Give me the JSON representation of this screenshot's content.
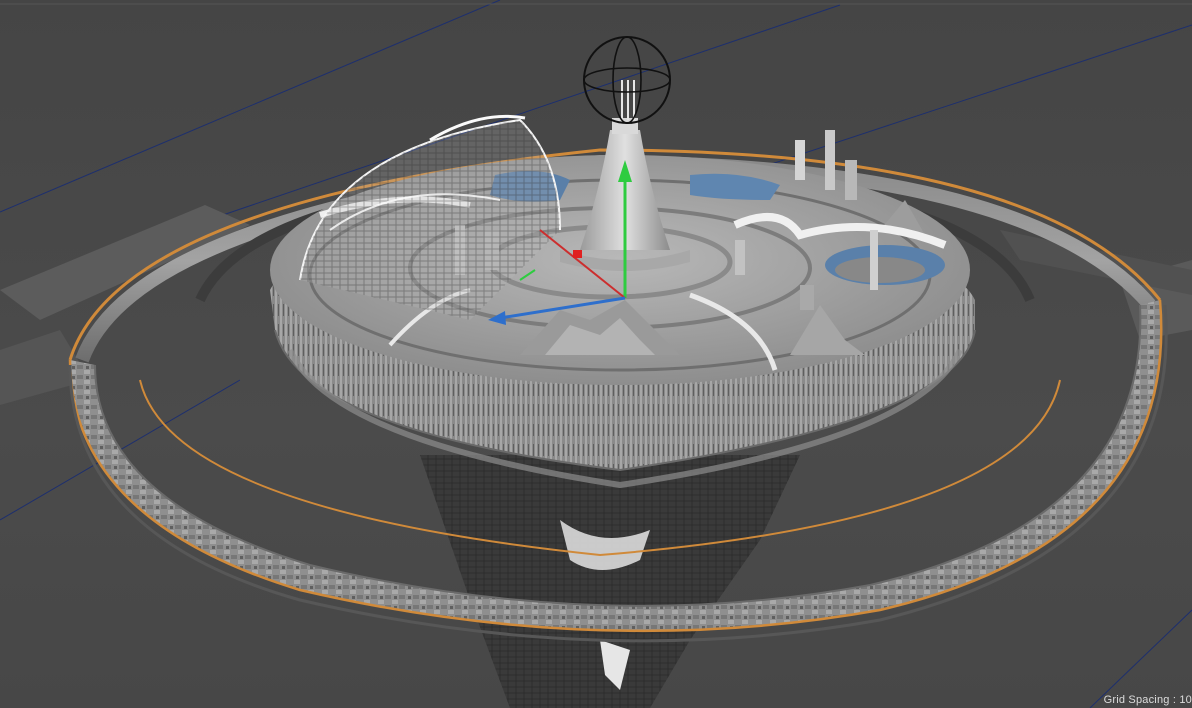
{
  "viewport": {
    "background_color": "#484848",
    "grid_line_color": "#1d2f6e",
    "selection_color": "#d08a3a",
    "model_color": "#9c9c9c"
  },
  "hud": {
    "grid_spacing_text": "Grid Spacing : 10"
  },
  "gizmos": {
    "axis_y_color": "#2ecc40",
    "axis_x_color": "#cc2e2e",
    "axis_z_color": "#2e6fcc"
  },
  "icons": [
    "sphere-null-icon",
    "move-gizmo-icon"
  ]
}
